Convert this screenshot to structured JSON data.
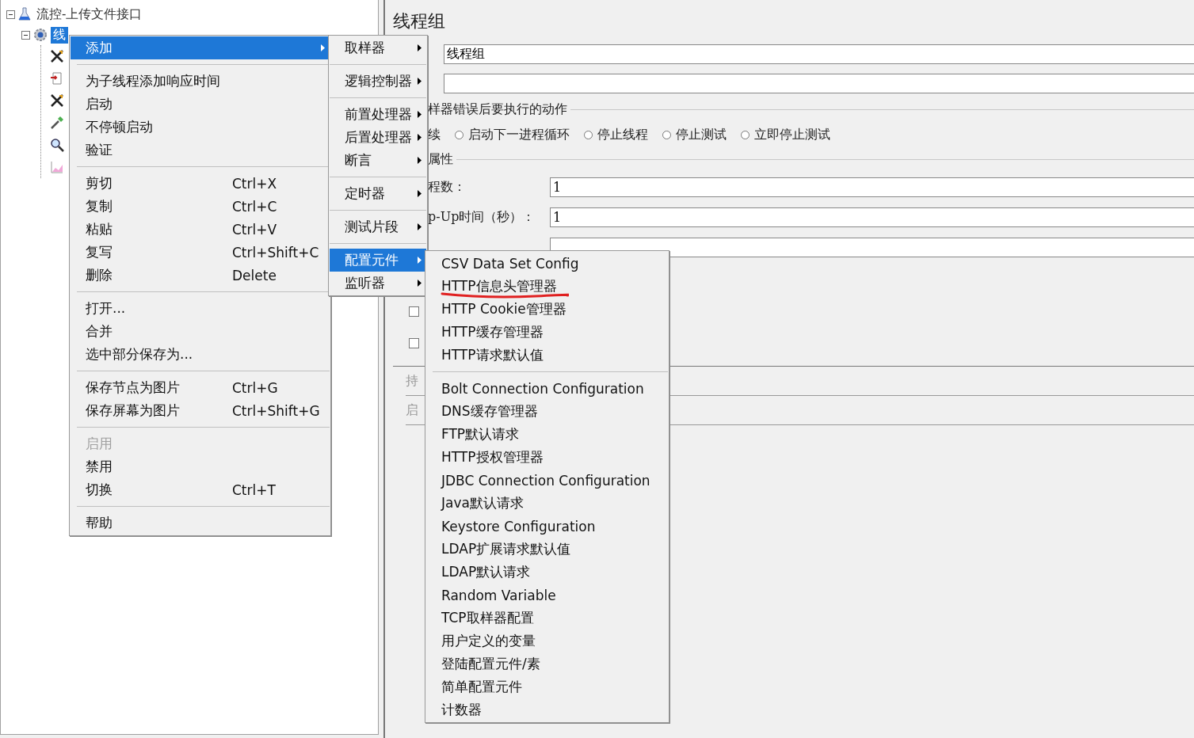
{
  "tree": {
    "root": {
      "label": "流控-上传文件接口",
      "expanded": true,
      "children": [
        {
          "label": "线",
          "selected": true,
          "expanded": true,
          "children": [
            {
              "kind": "tools"
            },
            {
              "kind": "doc"
            },
            {
              "kind": "tools"
            },
            {
              "kind": "dropper"
            },
            {
              "kind": "magnifier"
            },
            {
              "kind": "graph"
            }
          ]
        }
      ]
    }
  },
  "panel": {
    "title": "线程组",
    "name_field": {
      "value": "线程组"
    },
    "error_group": {
      "label": "样器错误后要执行的动作",
      "cut_option": "续",
      "options": [
        {
          "label": "启动下一进程循环",
          "selected": false
        },
        {
          "label": "停止线程",
          "selected": false
        },
        {
          "label": "停止测试",
          "selected": false
        },
        {
          "label": "立即停止测试",
          "selected": false
        }
      ]
    },
    "props_group": {
      "label": "属性",
      "fields": [
        {
          "label": "程数：",
          "value": "1"
        },
        {
          "label": "p-Up时间（秒）：",
          "value": "1"
        }
      ]
    },
    "checkboxes": [
      {
        "checked": false
      },
      {
        "checked": false
      }
    ],
    "cut_labels": [
      "持",
      "启"
    ]
  },
  "context_menu": {
    "groups": [
      [
        {
          "label": "添加",
          "selected": true,
          "submenu": true
        }
      ],
      [
        {
          "label": "为子线程添加响应时间"
        },
        {
          "label": "启动"
        },
        {
          "label": "不停顿启动"
        },
        {
          "label": "验证"
        }
      ],
      [
        {
          "label": "剪切",
          "shortcut": "Ctrl+X"
        },
        {
          "label": "复制",
          "shortcut": "Ctrl+C"
        },
        {
          "label": "粘贴",
          "shortcut": "Ctrl+V"
        },
        {
          "label": "复写",
          "shortcut": "Ctrl+Shift+C"
        },
        {
          "label": "删除",
          "shortcut": "Delete"
        }
      ],
      [
        {
          "label": "打开..."
        },
        {
          "label": "合并"
        },
        {
          "label": "选中部分保存为..."
        }
      ],
      [
        {
          "label": "保存节点为图片",
          "shortcut": "Ctrl+G"
        },
        {
          "label": "保存屏幕为图片",
          "shortcut": "Ctrl+Shift+G"
        }
      ],
      [
        {
          "label": "启用",
          "disabled": true
        },
        {
          "label": "禁用"
        },
        {
          "label": "切换",
          "shortcut": "Ctrl+T"
        }
      ],
      [
        {
          "label": "帮助"
        }
      ]
    ]
  },
  "add_submenu": {
    "groups": [
      [
        {
          "label": "取样器",
          "submenu": true
        }
      ],
      [
        {
          "label": "逻辑控制器",
          "submenu": true
        }
      ],
      [
        {
          "label": "前置处理器",
          "submenu": true
        },
        {
          "label": "后置处理器",
          "submenu": true
        },
        {
          "label": "断言",
          "submenu": true
        }
      ],
      [
        {
          "label": "定时器",
          "submenu": true
        }
      ],
      [
        {
          "label": "测试片段",
          "submenu": true
        }
      ],
      [
        {
          "label": "配置元件",
          "submenu": true,
          "selected": true
        },
        {
          "label": "监听器",
          "submenu": true
        }
      ]
    ]
  },
  "config_submenu": {
    "groups": [
      [
        {
          "label": "CSV Data Set Config"
        },
        {
          "label": "HTTP信息头管理器",
          "annotated": true
        },
        {
          "label": "HTTP Cookie管理器"
        },
        {
          "label": "HTTP缓存管理器"
        },
        {
          "label": "HTTP请求默认值"
        }
      ],
      [
        {
          "label": "Bolt Connection Configuration"
        },
        {
          "label": "DNS缓存管理器"
        },
        {
          "label": "FTP默认请求"
        },
        {
          "label": "HTTP授权管理器"
        },
        {
          "label": "JDBC Connection Configuration"
        },
        {
          "label": "Java默认请求"
        },
        {
          "label": "Keystore Configuration"
        },
        {
          "label": "LDAP扩展请求默认值"
        },
        {
          "label": "LDAP默认请求"
        },
        {
          "label": "Random Variable"
        },
        {
          "label": "TCP取样器配置"
        },
        {
          "label": "用户定义的变量"
        },
        {
          "label": "登陆配置元件/素"
        },
        {
          "label": "简单配置元件"
        },
        {
          "label": "计数器"
        }
      ]
    ]
  }
}
